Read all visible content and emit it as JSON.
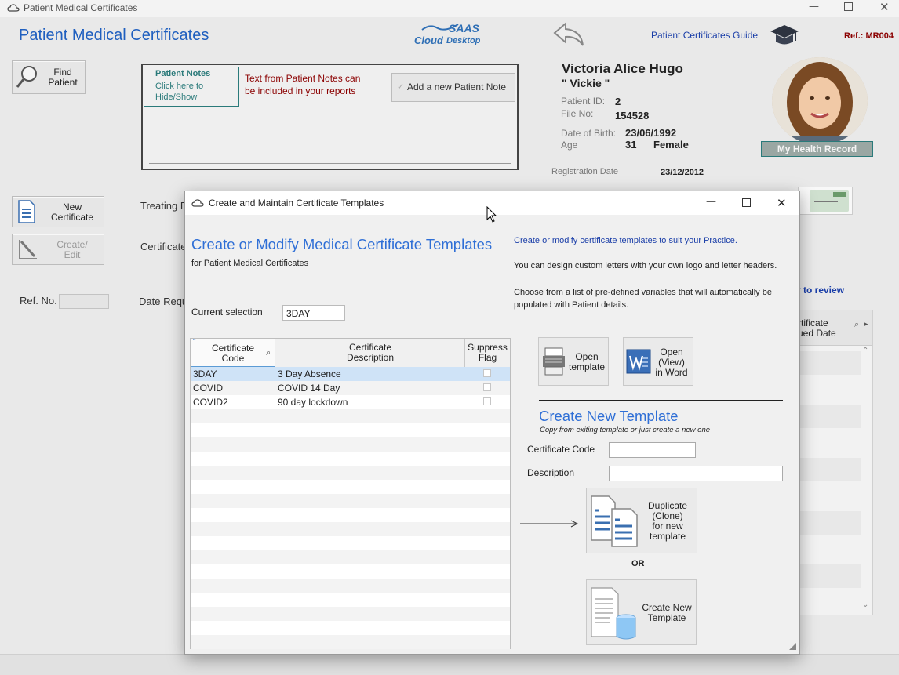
{
  "main_window": {
    "title": "Patient Medical Certificates",
    "heading": "Patient Medical Certificates",
    "logo_saas": "SAAS",
    "logo_cloud": "Cloud",
    "logo_desktop": "Desktop",
    "guide_link": "Patient Certificates Guide",
    "ref": "Ref.: MR004",
    "find_patient_label": "Find\nPatient",
    "new_certificate_label": "New\nCertificate",
    "create_edit_label": "Create/\nEdit",
    "treating_label": "Treating D",
    "certificate_label": "Certificate",
    "ref_no_label": "Ref. No.",
    "date_req_label": "Date Requ",
    "review_link": "r to review",
    "table_col_header": "rtificate\nued Date"
  },
  "patient_notes": {
    "title": "Patient Notes",
    "subtitle": "Click here to\nHide/Show",
    "info_text": "Text from Patient Notes can\nbe included in your reports",
    "add_note_label": "Add a new Patient Note"
  },
  "patient": {
    "name": "Victoria Alice Hugo",
    "nickname": "\" Vickie \"",
    "id_label": "Patient ID:",
    "id_value": "2",
    "file_label": "File No:",
    "file_value": "154528",
    "dob_label": "Date of Birth:",
    "dob_value": "23/06/1992",
    "age_label": "Age",
    "age_value": "31",
    "gender": "Female",
    "reg_label": "Registration Date",
    "reg_value": "23/12/2012",
    "health_record_label": "My Health Record"
  },
  "dialog": {
    "title": "Create and Maintain Certificate Templates",
    "heading": "Create or Modify Medical Certificate Templates",
    "subheading": "for Patient Medical Certificates",
    "current_selection_label": "Current selection",
    "current_selection_value": "3DAY",
    "info_line1": "Create or modify certificate templates to suit your Practice.",
    "info_line2": "You can design custom letters with your own logo and letter headers.",
    "info_line3": "Choose from a list of pre-defined variables that will automatically be populated with Patient details.",
    "columns": [
      "Certificate\nCode",
      "Certificate\nDescription",
      "Suppress\nFlag"
    ],
    "rows": [
      {
        "code": "3DAY",
        "description": "3 Day Absence"
      },
      {
        "code": "COVID",
        "description": "COVID 14 Day"
      },
      {
        "code": "COVID2",
        "description": "90 day lockdown"
      }
    ],
    "open_template_label": "Open\ntemplate",
    "open_word_label": "Open\n(View)\nin Word",
    "create_new_heading": "Create New Template",
    "create_new_sub": "Copy from exiting template or just create a new one",
    "cert_code_label": "Certificate Code",
    "description_label": "Description",
    "duplicate_label": "Duplicate\n(Clone)\nfor new\ntemplate",
    "or_label": "OR",
    "create_template_label": "Create New\nTemplate"
  },
  "colors": {
    "accent_blue": "#2f6fd6",
    "heading_blue": "#1f5fbf",
    "dark_red": "#8b0000",
    "teal": "#2a7a7a",
    "selected_row": "#cfe3f7"
  }
}
